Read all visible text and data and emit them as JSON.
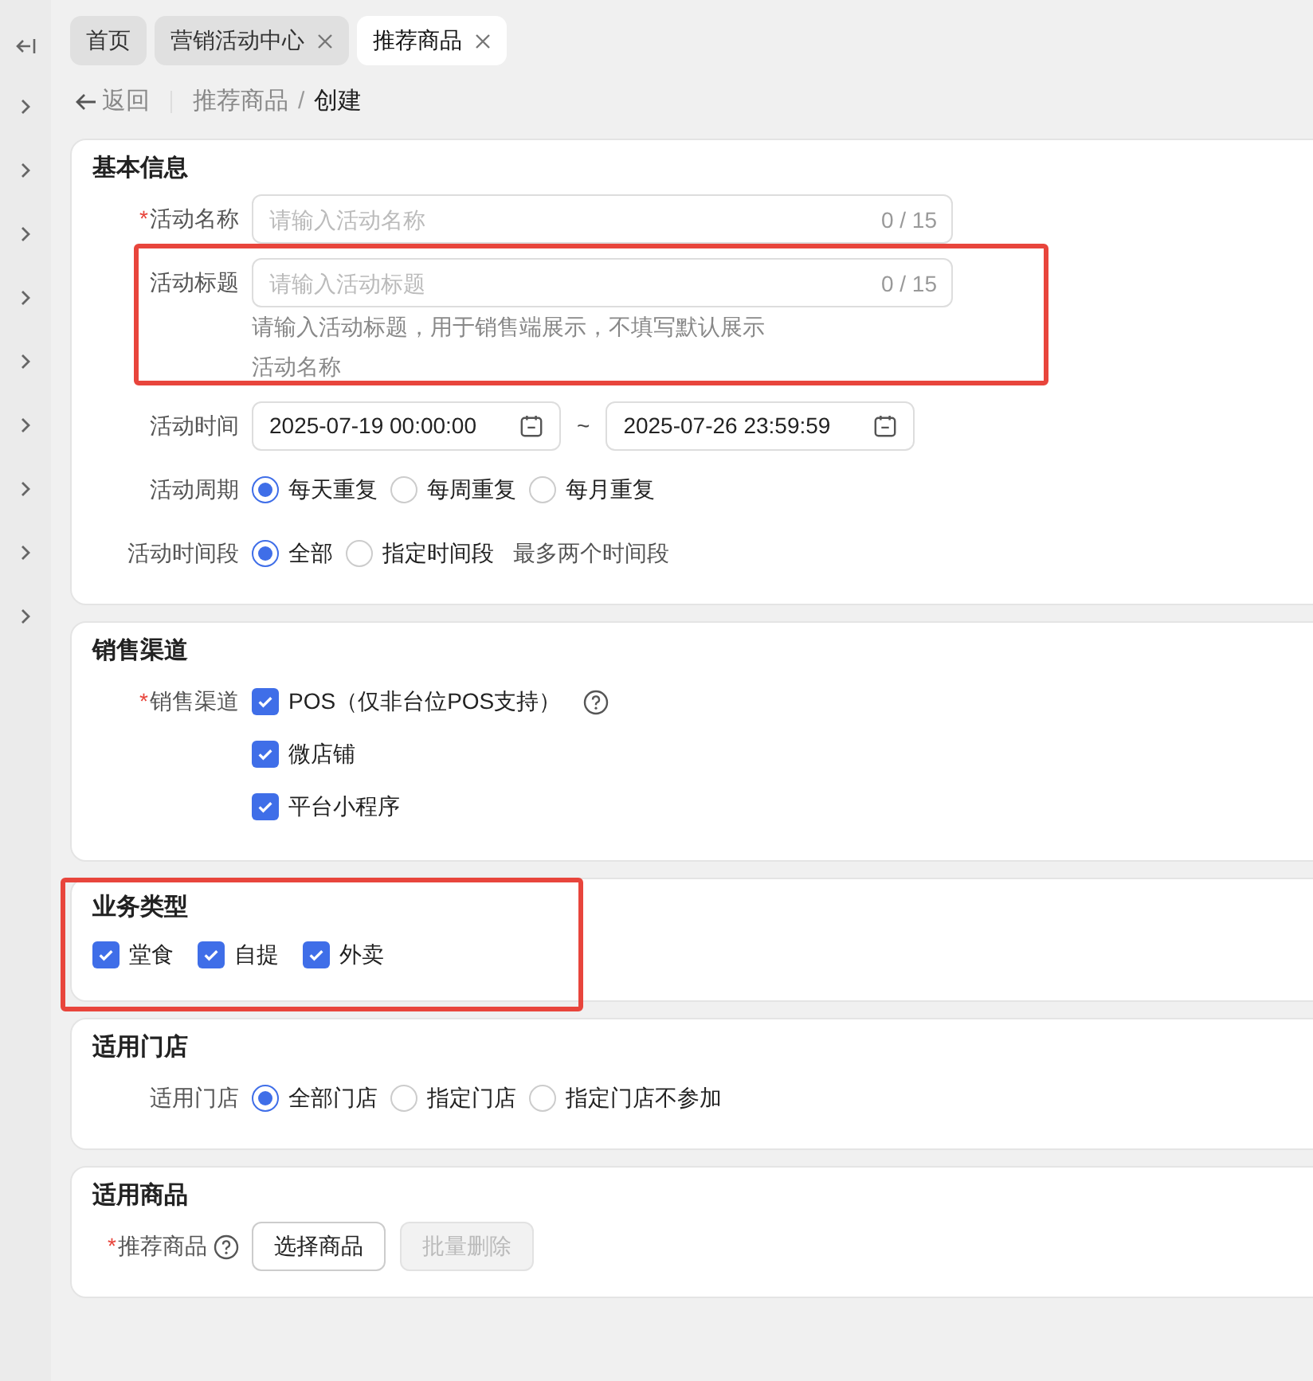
{
  "tabs": [
    {
      "label": "首页",
      "closable": false,
      "selected": false
    },
    {
      "label": "营销活动中心",
      "closable": true,
      "selected": false
    },
    {
      "label": "推荐商品",
      "closable": true,
      "selected": true
    }
  ],
  "breadcrumb": {
    "back": "返回",
    "separator": "/",
    "items": [
      "推荐商品",
      "创建"
    ]
  },
  "required_mark": "*",
  "sections": [
    {
      "title": "基本信息",
      "fields": [
        {
          "kind": "text_input",
          "label": "活动名称",
          "required": true,
          "placeholder": "请输入活动名称",
          "counter": "0 / 15"
        },
        {
          "kind": "text_input",
          "label": "活动标题",
          "placeholder": "请输入活动标题",
          "counter": "0 / 15",
          "help": [
            "请输入活动标题，用于销售端展示，不填写默认展示",
            "活动名称"
          ],
          "highlighted": true
        },
        {
          "kind": "date_range",
          "label": "活动时间",
          "start": "2025-07-19 00:00:00",
          "separator": "~",
          "end": "2025-07-26 23:59:59"
        },
        {
          "kind": "radio",
          "label": "活动周期",
          "options": [
            {
              "label": "每天重复",
              "selected": true
            },
            {
              "label": "每周重复",
              "selected": false
            },
            {
              "label": "每月重复",
              "selected": false
            }
          ]
        },
        {
          "kind": "radio",
          "label": "活动时间段",
          "options": [
            {
              "label": "全部",
              "selected": true
            },
            {
              "label": "指定时间段",
              "selected": false
            }
          ],
          "note": "最多两个时间段"
        }
      ]
    },
    {
      "title": "销售渠道",
      "fields": [
        {
          "kind": "checkbox_list",
          "label": "销售渠道",
          "required": true,
          "options": [
            {
              "label": "POS（仅非台位POS支持）",
              "checked": true,
              "help_icon": true
            },
            {
              "label": "微店铺",
              "checked": true
            },
            {
              "label": "平台小程序",
              "checked": true
            }
          ]
        }
      ]
    },
    {
      "title": "业务类型",
      "highlighted": true,
      "fields": [
        {
          "kind": "checkbox_inline",
          "options": [
            {
              "label": "堂食",
              "checked": true
            },
            {
              "label": "自提",
              "checked": true
            },
            {
              "label": "外卖",
              "checked": true
            }
          ]
        }
      ]
    },
    {
      "title": "适用门店",
      "fields": [
        {
          "kind": "radio",
          "label": "适用门店",
          "options": [
            {
              "label": "全部门店",
              "selected": true
            },
            {
              "label": "指定门店",
              "selected": false
            },
            {
              "label": "指定门店不参加",
              "selected": false
            }
          ]
        }
      ]
    },
    {
      "title": "适用商品",
      "fields": [
        {
          "kind": "buttons",
          "label": "推荐商品",
          "required": true,
          "help_icon": true,
          "buttons": [
            {
              "label": "选择商品",
              "disabled": false
            },
            {
              "label": "批量删除",
              "disabled": true
            }
          ]
        }
      ]
    }
  ]
}
